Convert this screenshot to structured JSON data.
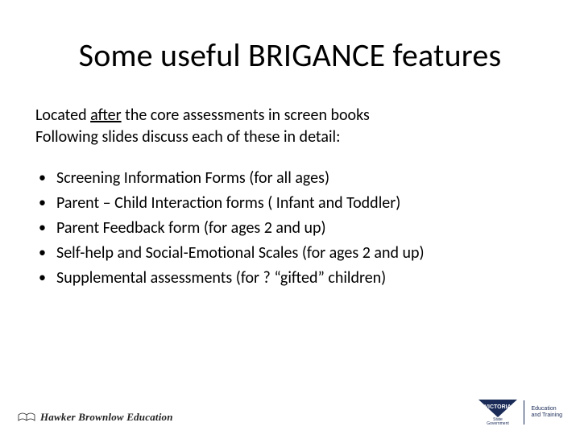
{
  "title": "Some useful BRIGANCE features",
  "intro": {
    "line1_pre": "Located ",
    "line1_underlined": "after",
    "line1_post": " the core assessments in screen books",
    "line2": "Following slides discuss each of these in detail:"
  },
  "bullets": [
    "Screening Information Forms (for all ages)",
    "Parent – Child Interaction forms ( Infant and Toddler)",
    "Parent Feedback form (for ages 2 and up)",
    "Self-help and Social-Emotional Scales (for ages 2 and up)",
    "Supplemental assessments (for ? “gifted” children)"
  ],
  "footer": {
    "hbe_text": "Hawker Brownlow Education",
    "vic_main": "VICTORIA",
    "vic_sub1": "State",
    "vic_sub2": "Government",
    "edu1": "Education",
    "edu2": "and Training"
  }
}
